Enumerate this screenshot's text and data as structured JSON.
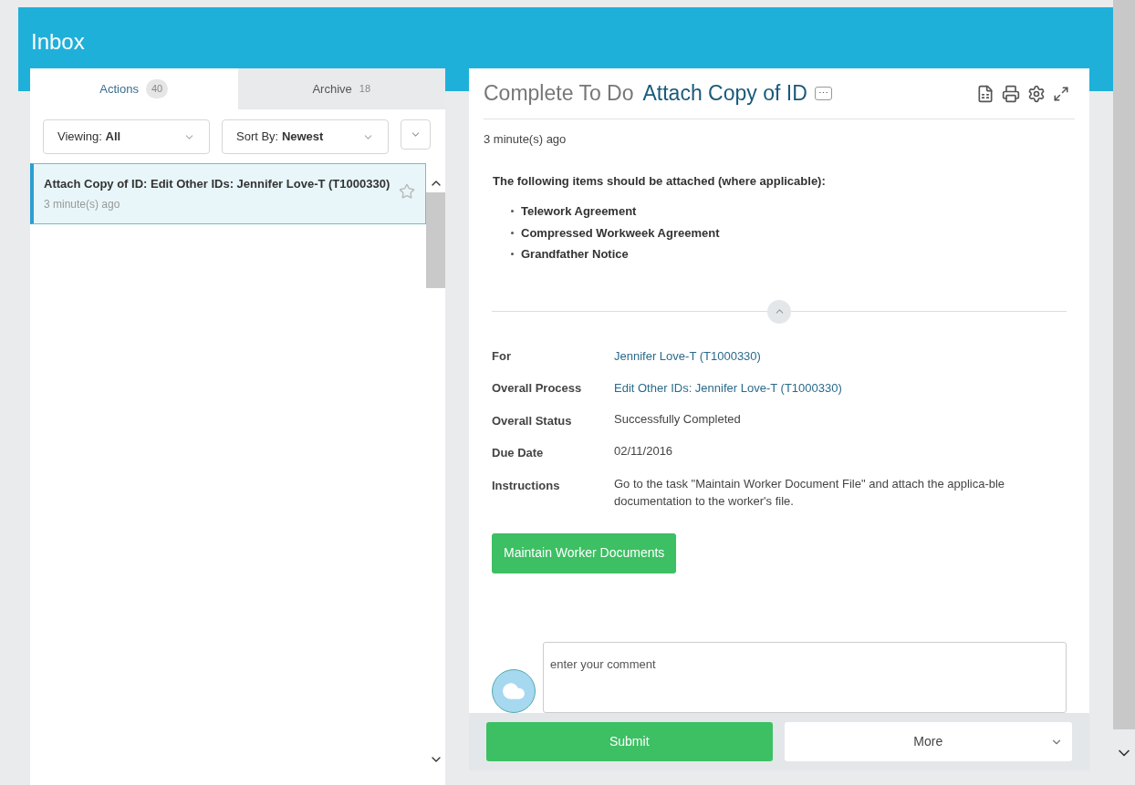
{
  "header": {
    "title": "Inbox"
  },
  "tabs": [
    {
      "label": "Actions",
      "count": "40",
      "selected": true
    },
    {
      "label": "Archive",
      "count": "18",
      "selected": false
    }
  ],
  "filters": [
    {
      "label": "Viewing:",
      "value": "All"
    },
    {
      "label": "Sort By:",
      "value": "Newest"
    }
  ],
  "items": [
    {
      "title": "Attach Copy of ID: Edit Other IDs: Jennifer Love-T (T1000330)",
      "time": "3 minute(s) ago",
      "selected": true,
      "starred": false
    }
  ],
  "detail": {
    "prefix": "Complete To Do",
    "title": "Attach Copy of ID",
    "more": "⋯",
    "time": "3 minute(s) ago",
    "intro": "The following items should be attached (where applicable):",
    "bullets": [
      "Telework Agreement",
      "Compressed Workweek Agreement",
      "Grandfather Notice"
    ],
    "fields": [
      {
        "label": "For",
        "value": "Jennifer Love-T (T1000330)",
        "kind": "link"
      },
      {
        "label": "Overall Process",
        "value": "Edit Other IDs: Jennifer Love-T (T1000330)",
        "kind": "link"
      },
      {
        "label": "Overall Status",
        "value": "Successfully Completed",
        "kind": "text"
      },
      {
        "label": "Due Date",
        "value": "02/11/2016",
        "kind": "text"
      },
      {
        "label": "Instructions",
        "value": "Go to the task \"Maintain Worker Document File\" and attach the applica-ble documentation to the worker's file.",
        "kind": "text"
      }
    ],
    "action": "Maintain Worker Documents",
    "comment": {
      "placeholder": "enter your comment"
    },
    "buttons": [
      {
        "label": "Submit",
        "kind": "primary"
      },
      {
        "label": "More",
        "kind": "menu"
      }
    ]
  }
}
